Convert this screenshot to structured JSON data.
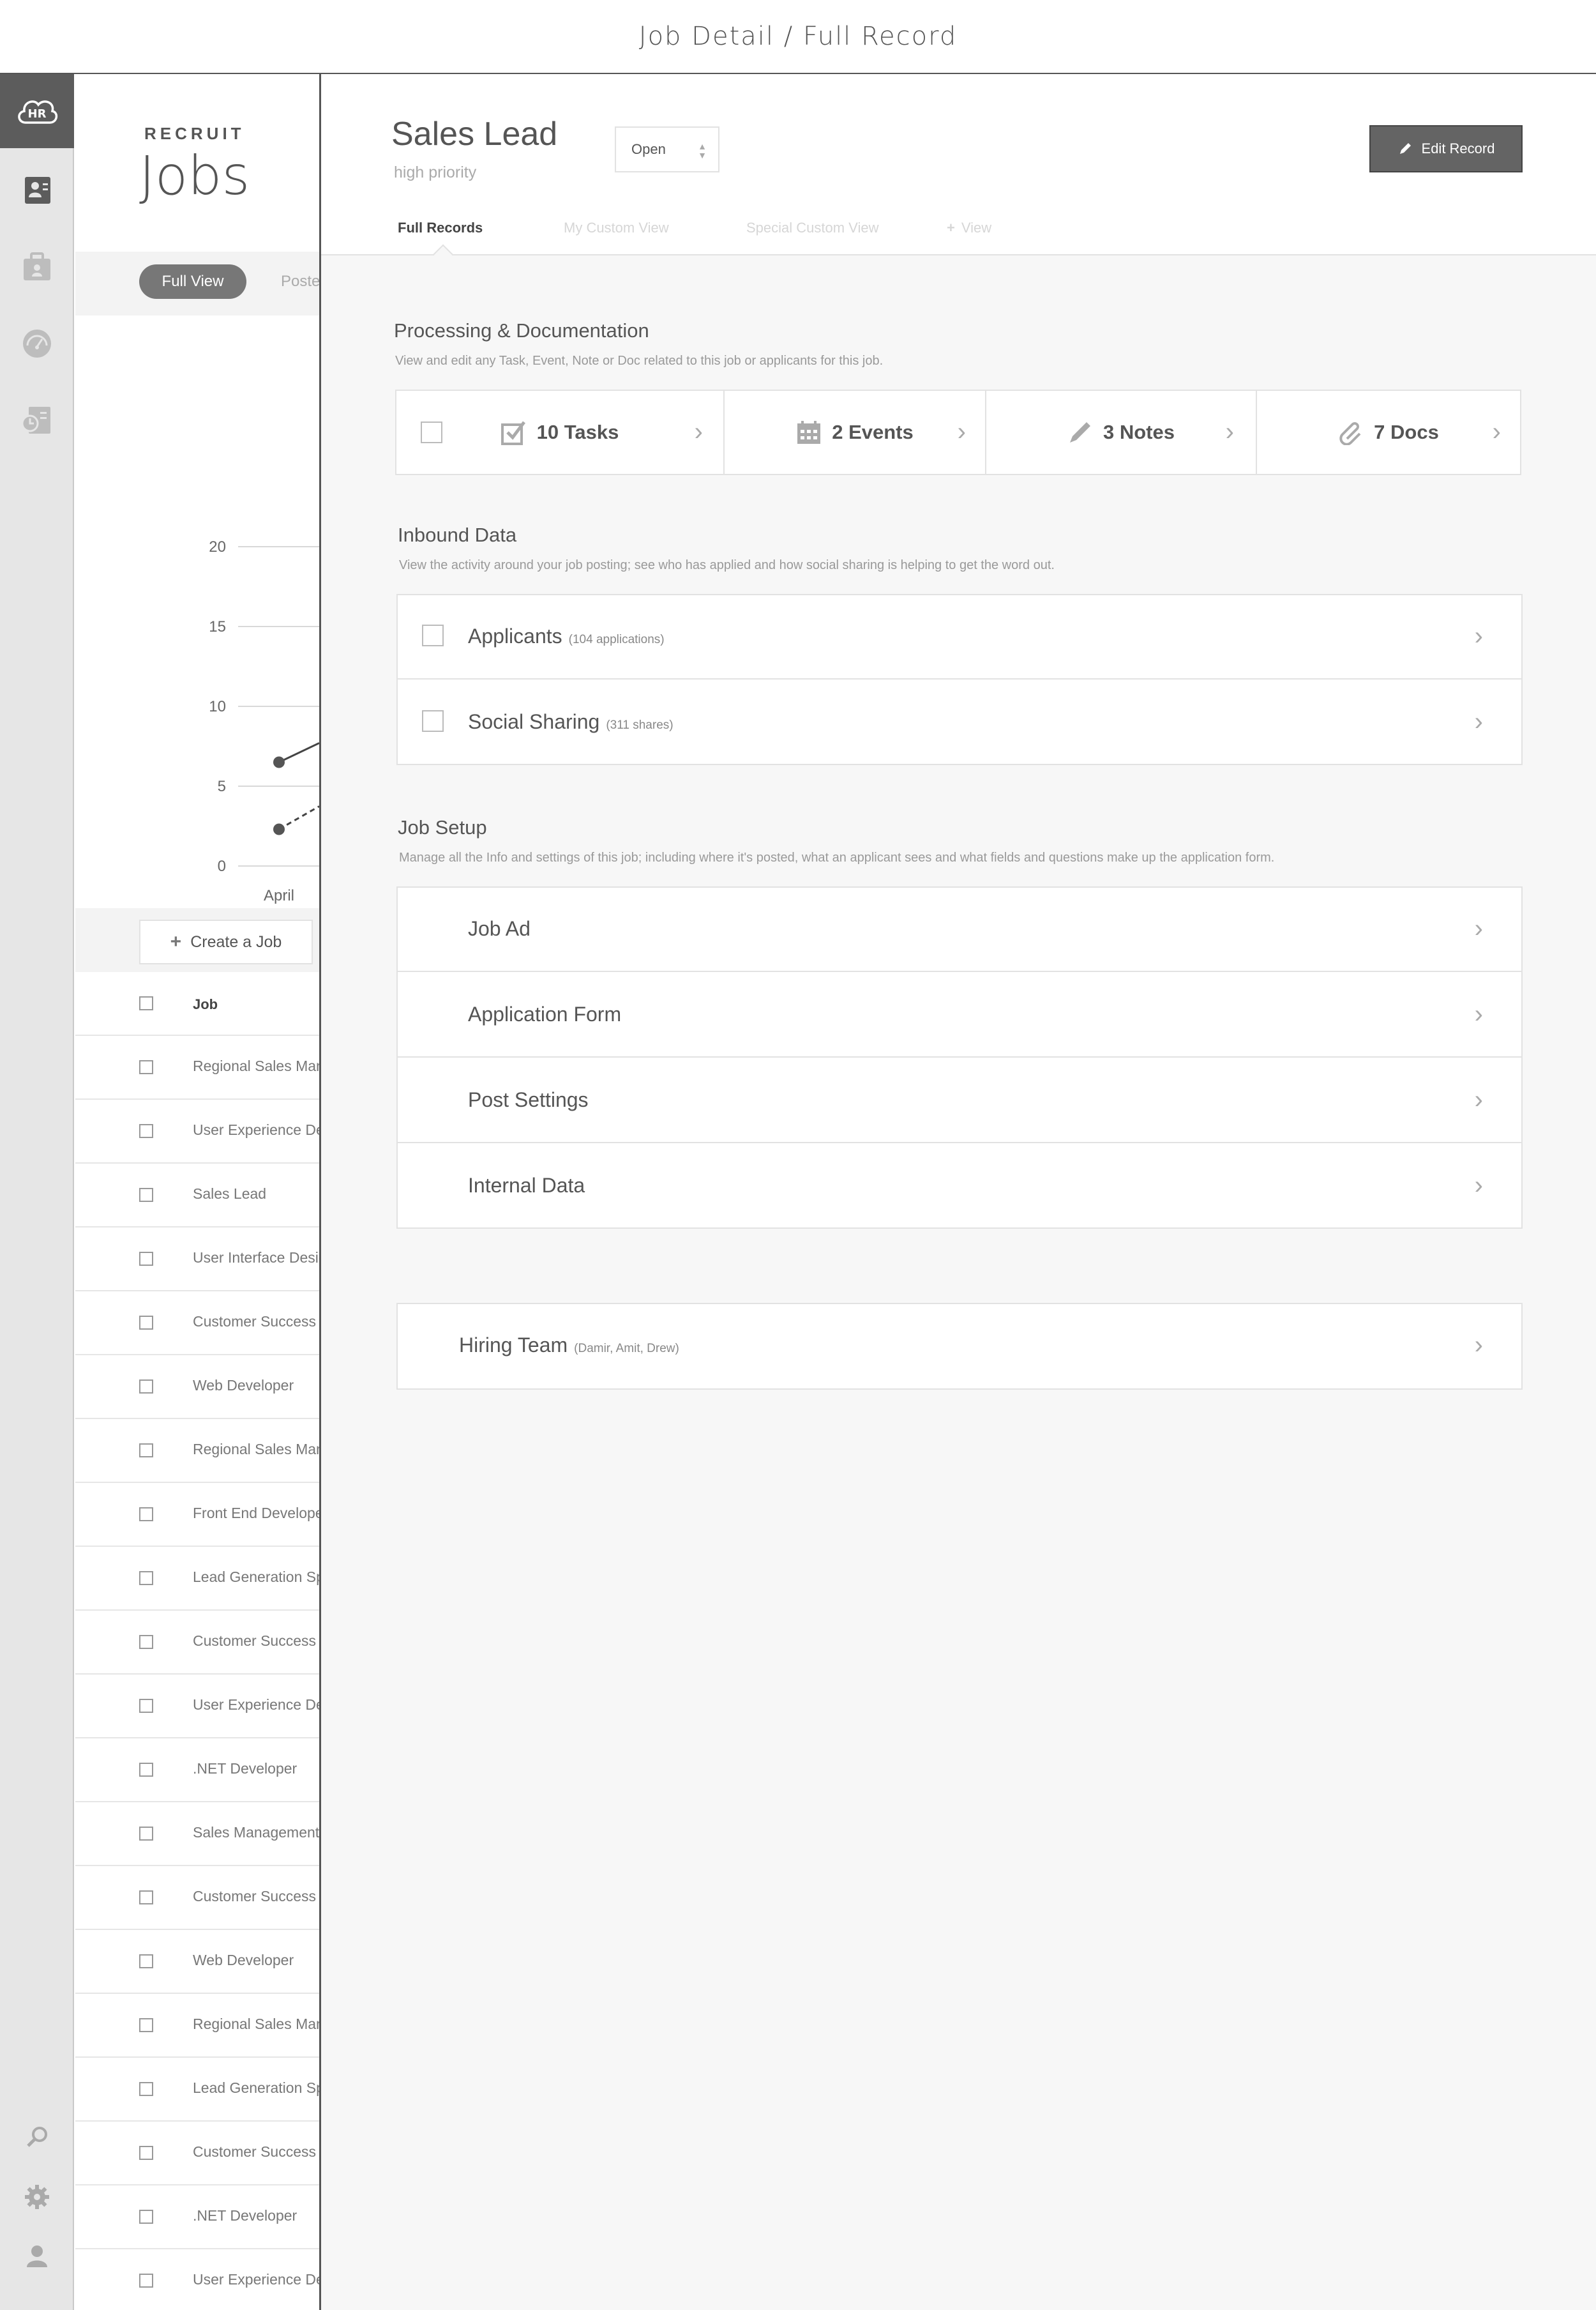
{
  "page_title": "Job Detail / Full Record",
  "rail": {
    "logo": "HR",
    "nav_icons": [
      "candidates-icon",
      "jobs-icon",
      "dashboard-icon",
      "reports-icon"
    ],
    "bottom_icons": [
      "search-icon",
      "gear-icon",
      "user-icon"
    ]
  },
  "list": {
    "eyebrow": "RECRUIT",
    "title": "Jobs",
    "views": {
      "active": "Full View",
      "next": "Posted"
    },
    "chart_data": {
      "type": "line",
      "y_ticks": [
        "20",
        "15",
        "10",
        "5",
        "0"
      ],
      "ylim": [
        0,
        20
      ],
      "categories": [
        "April"
      ],
      "series": [
        {
          "style": "solid",
          "values": [
            6.5
          ]
        },
        {
          "style": "dashed",
          "values": [
            2.3
          ]
        }
      ]
    },
    "create_label": "Create a Job",
    "header_label": "Job",
    "rows": [
      "Regional Sales Manager",
      "User Experience Designer",
      "Sales Lead",
      "User Interface Designer",
      "Customer Success Manager",
      "Web Developer",
      "Regional Sales Manager",
      "Front End Developer",
      "Lead Generation Specialist",
      "Customer Success Manager",
      "User Experience Designer",
      ".NET Developer",
      "Sales Management",
      "Customer Success Manager",
      "Web Developer",
      "Regional Sales Manager",
      "Lead Generation Specialist",
      "Customer Success Manager",
      ".NET Developer",
      "User Experience Designer"
    ]
  },
  "detail": {
    "title": "Sales Lead",
    "subtitle": "high priority",
    "status": "Open",
    "edit_label": "Edit Record",
    "tabs": [
      "Full Records",
      "My Custom View",
      "Special Custom View",
      "View"
    ],
    "processing": {
      "title": "Processing & Documentation",
      "desc": "View and edit any Task, Event, Note or Doc related to this job or applicants for this job.",
      "tiles": [
        {
          "label": "10 Tasks",
          "icon": "task-check-icon"
        },
        {
          "label": "2 Events",
          "icon": "calendar-icon"
        },
        {
          "label": "3 Notes",
          "icon": "pencil-icon"
        },
        {
          "label": "7 Docs",
          "icon": "paperclip-icon"
        }
      ]
    },
    "inbound": {
      "title": "Inbound Data",
      "desc": "View the activity around your job posting; see who has applied and how social sharing is helping to get the word out.",
      "items": [
        {
          "label": "Applicants",
          "note": "(104 applications)"
        },
        {
          "label": "Social Sharing",
          "note": "(311 shares)"
        }
      ]
    },
    "setup": {
      "title": "Job Setup",
      "desc": "Manage all the Info and settings of this job; including where it's posted, what an applicant sees and what fields and questions make up the application form.",
      "items": [
        "Job Ad",
        "Application Form",
        "Post Settings",
        "Internal Data"
      ]
    },
    "hiring": {
      "label": "Hiring Team",
      "note": "(Damir, Amit, Drew)"
    }
  }
}
